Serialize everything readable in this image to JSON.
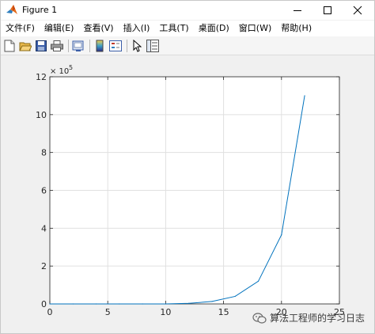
{
  "window": {
    "title": "Figure 1",
    "controls": {
      "minimize_icon": "minimize-icon",
      "maximize_icon": "maximize-icon",
      "close_icon": "close-icon"
    }
  },
  "menu": {
    "items": [
      "文件(F)",
      "编辑(E)",
      "查看(V)",
      "插入(I)",
      "工具(T)",
      "桌面(D)",
      "窗口(W)",
      "帮助(H)"
    ]
  },
  "toolbar": {
    "icons": [
      "new-figure-icon",
      "open-file-icon",
      "save-icon",
      "print-icon",
      "link-plot-icon",
      "insert-colorbar-icon",
      "insert-legend-icon",
      "edit-plot-icon",
      "property-inspector-icon"
    ]
  },
  "chart_data": {
    "type": "line",
    "x": [
      0,
      2,
      4,
      6,
      8,
      10,
      12,
      14,
      16,
      18,
      20,
      22
    ],
    "series": [
      {
        "values": [
          0,
          0,
          0,
          0,
          0,
          0,
          3000,
          13000,
          40000,
          120000,
          365000,
          1100000
        ],
        "color": "#0072bd"
      }
    ],
    "xlim": [
      0,
      25
    ],
    "ylim": [
      0,
      1200000
    ],
    "xticks": [
      "0",
      "5",
      "10",
      "15",
      "20",
      "25"
    ],
    "yticks": [
      "0",
      "2",
      "4",
      "6",
      "8",
      "10",
      "12"
    ],
    "y_exponent": {
      "base": "× 10",
      "power": "5"
    },
    "grid": true,
    "title": "",
    "xlabel": "",
    "ylabel": ""
  },
  "watermark": {
    "text": "算法工程师的学习日志"
  }
}
